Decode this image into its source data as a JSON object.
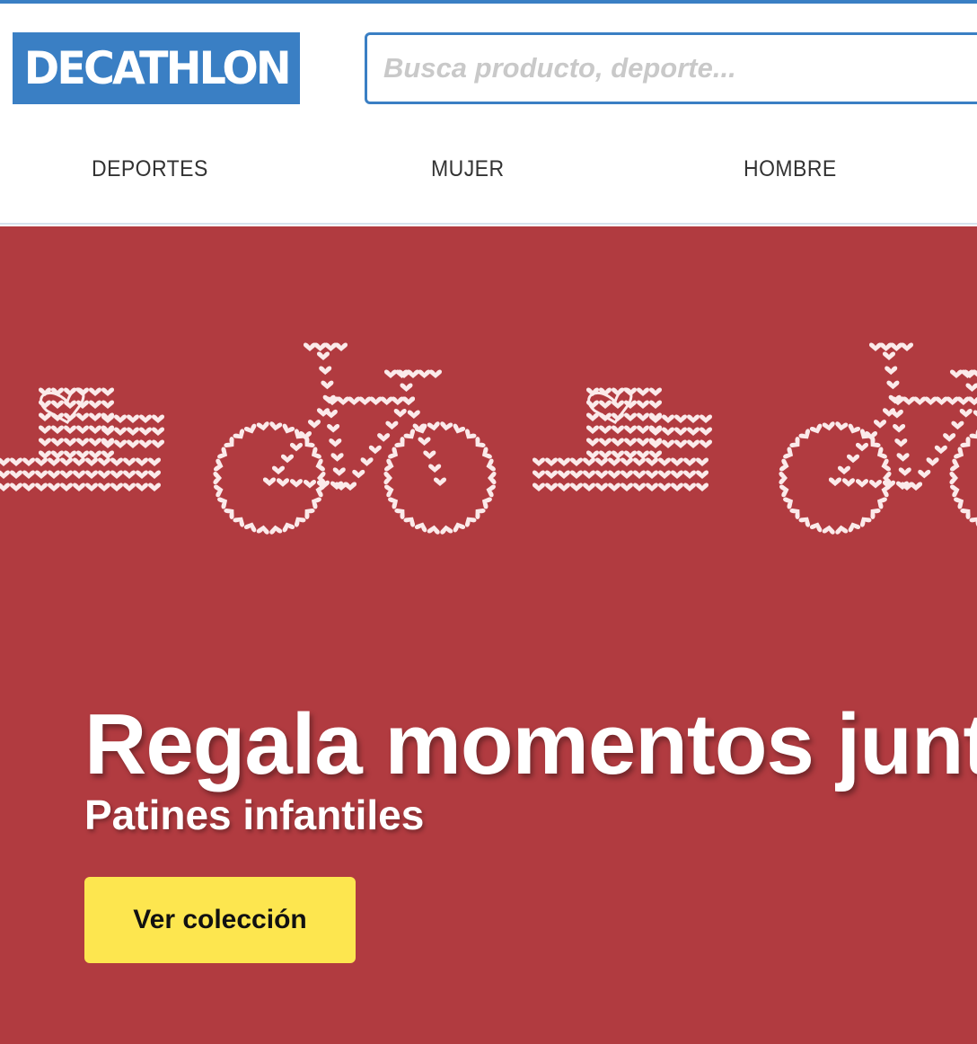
{
  "brand": {
    "logo_text": "DECATHLON",
    "color": "#3a7fc4"
  },
  "search": {
    "placeholder": "Busca producto, deporte..."
  },
  "nav": {
    "items": [
      {
        "label": "DEPORTES"
      },
      {
        "label": "MUJER"
      },
      {
        "label": "HOMBRE"
      }
    ]
  },
  "hero": {
    "background_color": "#b13b40",
    "title": "Regala momentos juntos",
    "subtitle": "Patines infantiles",
    "cta_label": "Ver colección",
    "cta_color": "#fde64f",
    "illustration": [
      "skate-icon",
      "bicycle-icon",
      "skate-icon",
      "bicycle-icon"
    ]
  }
}
